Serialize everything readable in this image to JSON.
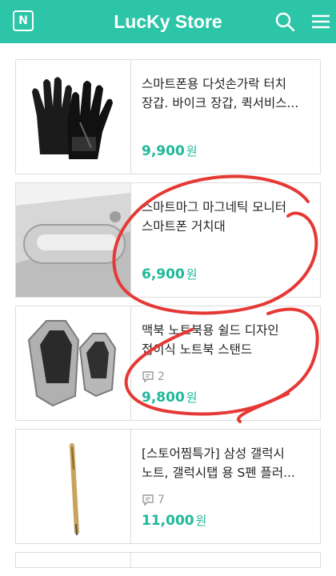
{
  "header": {
    "logo_letter": "N",
    "title": "LucKy Store",
    "brand_color": "#2cc5a8"
  },
  "products": [
    {
      "title": "스마트폰용 다섯손가락 터치 장갑. 바이크 장갑, 퀵서비스...",
      "comments": "",
      "price": "9,900",
      "currency": "원",
      "image": "touch-gloves-image"
    },
    {
      "title": "스마트마그 마그네틱 모니터 스마트폰 거치대",
      "comments": "",
      "price": "6,900",
      "currency": "원",
      "image": "magnetic-stand-image"
    },
    {
      "title": "맥북 노트북용 쉴드 디자인 접이식 노트북 스탠드",
      "comments": "2",
      "price": "9,800",
      "currency": "원",
      "image": "laptop-stand-image"
    },
    {
      "title": "[스토어찜특가] 삼성 갤럭시 노트, 갤럭시탭 용 S펜 플러...",
      "comments": "7",
      "price": "11,000",
      "currency": "원",
      "image": "stylus-pen-image"
    }
  ],
  "annotation_color": "#e53935"
}
